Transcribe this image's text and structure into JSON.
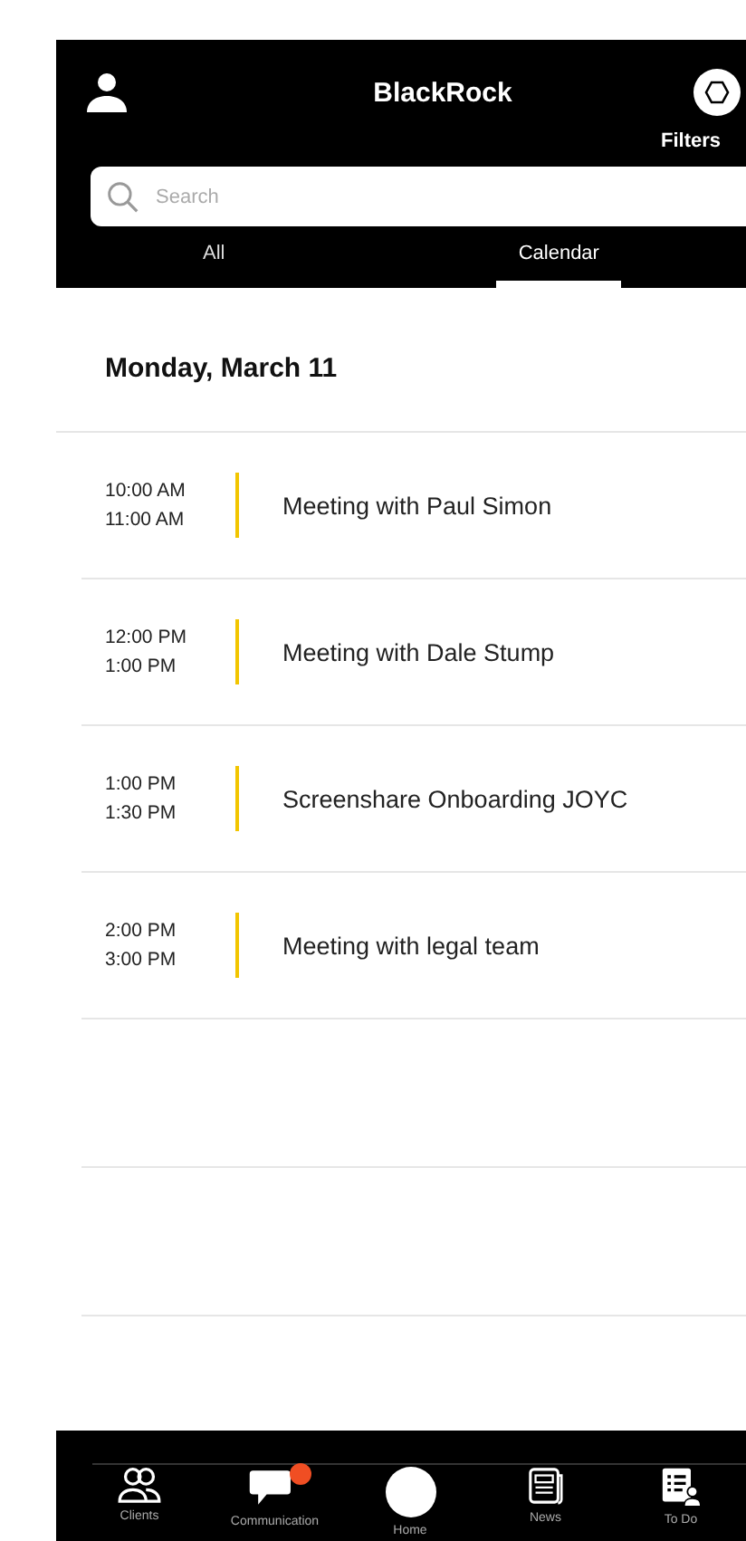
{
  "header": {
    "brand": "BlackRock",
    "filters_label": "Filters"
  },
  "search": {
    "placeholder": "Search"
  },
  "tabs": [
    {
      "label": "All",
      "selected": false
    },
    {
      "label": "Calendar",
      "selected": true
    }
  ],
  "date_heading": "Monday, March 11",
  "events": [
    {
      "start": "10:00 AM",
      "end": "11:00 AM",
      "title": "Meeting with Paul Simon",
      "color": "#f2c500"
    },
    {
      "start": "12:00 PM",
      "end": "1:00 PM",
      "title": "Meeting with Dale Stump",
      "color": "#f2c500"
    },
    {
      "start": "1:00 PM",
      "end": "1:30 PM",
      "title": "Screenshare Onboarding JOYC",
      "color": "#f2c500"
    },
    {
      "start": "2:00 PM",
      "end": "3:00 PM",
      "title": "Meeting with legal team",
      "color": "#f2c500"
    }
  ],
  "bottom_nav": [
    {
      "kind": "clients",
      "label": "Clients",
      "badge": false
    },
    {
      "kind": "communication",
      "label": "Communication",
      "badge": true
    },
    {
      "kind": "home",
      "label": "Home",
      "badge": false
    },
    {
      "kind": "news",
      "label": "News",
      "badge": false
    },
    {
      "kind": "todo",
      "label": "To Do",
      "badge": false
    }
  ]
}
